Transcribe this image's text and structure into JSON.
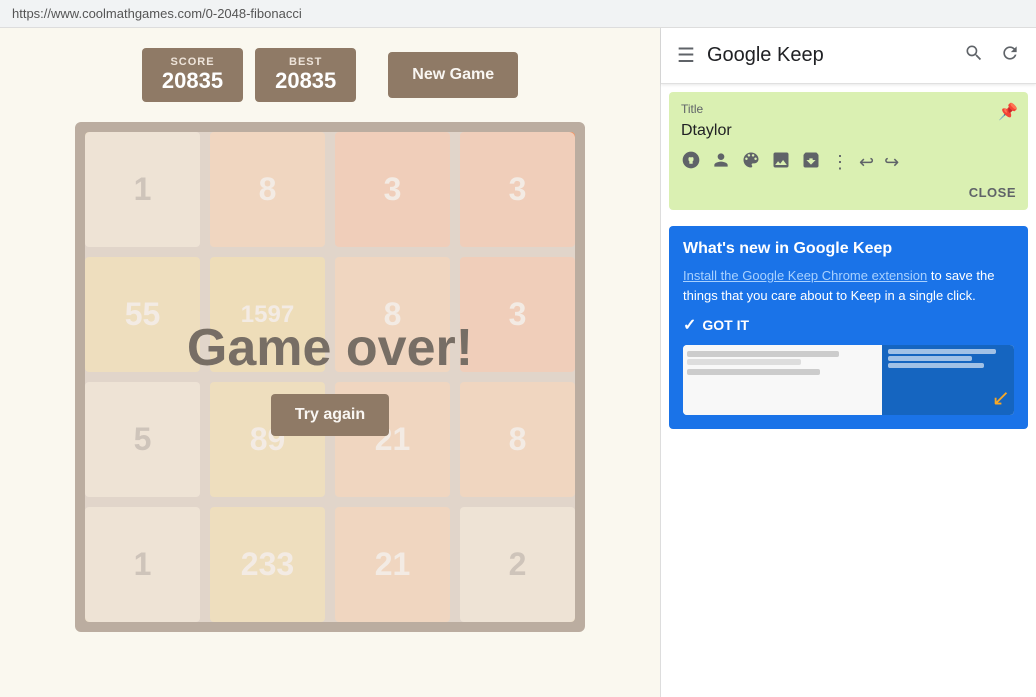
{
  "addressBar": {
    "url": "https://www.coolmathgames.com/0-2048-fibonacci"
  },
  "game": {
    "score_label": "SCORE",
    "best_label": "BEST",
    "score_value": "20835",
    "best_value": "20835",
    "new_game_label": "New Game",
    "game_over_text": "Game over!",
    "try_again_label": "Try again",
    "grid": [
      {
        "value": "1",
        "type": "tile-1"
      },
      {
        "value": "8",
        "type": "tile-8"
      },
      {
        "value": "3",
        "type": "tile-3"
      },
      {
        "value": "3",
        "type": "tile-3"
      },
      {
        "value": "55",
        "type": "tile-55"
      },
      {
        "value": "1597",
        "type": "tile-1597"
      },
      {
        "value": "8",
        "type": "tile-8"
      },
      {
        "value": "3",
        "type": "tile-3"
      },
      {
        "value": "5",
        "type": "tile-1"
      },
      {
        "value": "89",
        "type": "tile-89"
      },
      {
        "value": "21",
        "type": "tile-21"
      },
      {
        "value": "8",
        "type": "tile-8"
      },
      {
        "value": "1",
        "type": "tile-1"
      },
      {
        "value": "233",
        "type": "tile-233"
      },
      {
        "value": "21",
        "type": "tile-21"
      },
      {
        "value": "2",
        "type": "tile-1"
      }
    ]
  },
  "keep": {
    "header": {
      "logo": "Google Keep",
      "menu_icon": "☰",
      "search_icon": "⌕",
      "refresh_icon": "↻"
    },
    "note": {
      "title_label": "Title",
      "title_value": "Dtaylor",
      "close_label": "CLOSE",
      "pin_icon": "📌"
    },
    "whats_new": {
      "title": "What's new in Google Keep",
      "link_text": "Install the Google Keep Chrome extension",
      "body_text": " to save the things that you care about to Keep in a single click.",
      "got_it_label": "GOT IT"
    }
  }
}
